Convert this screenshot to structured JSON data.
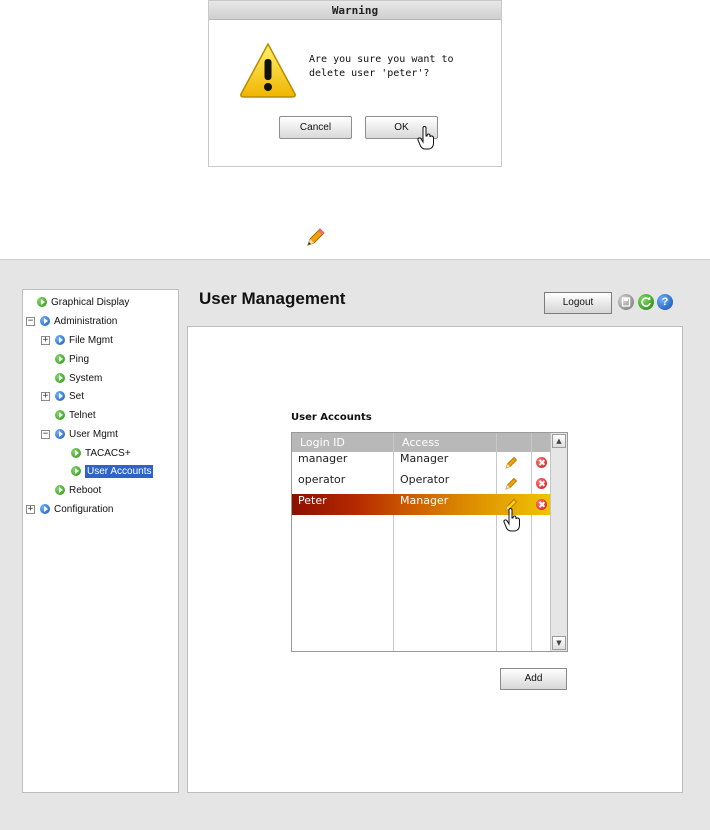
{
  "dialog": {
    "title": "Warning",
    "message": "Are you sure you want to\ndelete user 'peter'?",
    "cancel_label": "Cancel",
    "ok_label": "OK"
  },
  "sidebar": {
    "items": [
      {
        "label": "Graphical Display",
        "icon": "green"
      },
      {
        "label": "Administration",
        "icon": "blue",
        "expander": "−"
      },
      {
        "label": "File Mgmt",
        "icon": "blue",
        "expander": "+"
      },
      {
        "label": "Ping",
        "icon": "green"
      },
      {
        "label": "System",
        "icon": "green"
      },
      {
        "label": "Set",
        "icon": "blue",
        "expander": "+"
      },
      {
        "label": "Telnet",
        "icon": "green"
      },
      {
        "label": "User Mgmt",
        "icon": "blue",
        "expander": "−"
      },
      {
        "label": "TACACS+",
        "icon": "green"
      },
      {
        "label": "User Accounts",
        "icon": "green",
        "selected": true
      },
      {
        "label": "Reboot",
        "icon": "green"
      },
      {
        "label": "Configuration",
        "icon": "blue",
        "expander": "+"
      }
    ]
  },
  "header": {
    "title": "User Management",
    "logout_label": "Logout",
    "help_glyph": "?"
  },
  "accounts": {
    "section_title": "User Accounts",
    "columns": [
      "Login ID",
      "Access",
      "",
      ""
    ],
    "rows": [
      {
        "login": "manager",
        "access": "Manager",
        "selected": false
      },
      {
        "login": "operator",
        "access": "Operator",
        "selected": false
      },
      {
        "login": "Peter",
        "access": "Manager",
        "selected": true
      }
    ],
    "add_label": "Add"
  },
  "colors": {
    "selection_start": "#8c0f00",
    "selection_end": "#f0c400",
    "tree_selected": "#2f63c9"
  }
}
